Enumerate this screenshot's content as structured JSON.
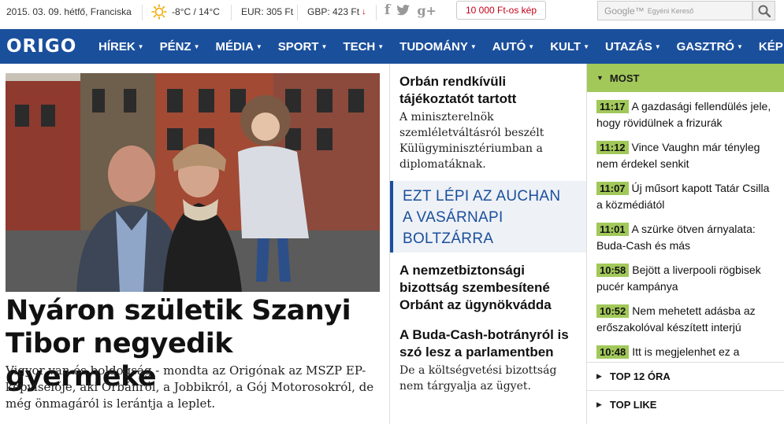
{
  "topbar": {
    "date": "2015. 03. 09. hétfő, Franciska",
    "weather": "-8°C / 14°C",
    "eur": "EUR: 305 Ft",
    "gbp": "GBP: 423 Ft",
    "gbp_trend": "↓",
    "promo": "10 000 Ft-os kép",
    "search_brand": "Google™",
    "search_placeholder": "Egyéni Kereső"
  },
  "nav": {
    "logo": "ORIGO",
    "items": [
      {
        "label": "HÍREK"
      },
      {
        "label": "PÉNZ"
      },
      {
        "label": "MÉDIA"
      },
      {
        "label": "SPORT"
      },
      {
        "label": "TECH"
      },
      {
        "label": "TUDOMÁNY"
      },
      {
        "label": "AUTÓ"
      },
      {
        "label": "KULT"
      },
      {
        "label": "UTAZÁS"
      },
      {
        "label": "GASZTRÓ"
      },
      {
        "label": "KÉP"
      }
    ]
  },
  "hero": {
    "title": "Nyáron születik Szanyi Tibor negyedik gyermeke",
    "lead": "Vigyor van és boldogság - mondta az Origónak az MSZP EP-képviselője, aki Orbánról, a Jobbikról, a Gój Motorosokról, de még önmagáról is lerántja a leplet."
  },
  "middle": {
    "story1_title": "Orbán rendkívüli tájékoztatót tartott",
    "story1_lead": "A miniszterelnök szemléletváltásról beszélt Külügyminisztériumban a diplomatáknak.",
    "feature_lines": [
      "EZT LÉPI AZ AUCHAN",
      "A VASÁRNAPI",
      "BOLTZÁRRA"
    ],
    "story2_title": "A nemzetbiztonsági bizottság szembesítené Orbánt az ügynökvádda",
    "story3_title": "A Buda-Cash-botrányról is szó lesz a parlamentben",
    "story3_lead": "De a költségvetési bizottság nem tárgyalja az ügyet."
  },
  "right": {
    "most_label": "MOST",
    "news": [
      {
        "time": "11:17",
        "text": "A gazdasági fellendülés jele, hogy rövidülnek a frizurák"
      },
      {
        "time": "11:12",
        "text": "Vince Vaughn már tényleg nem érdekel senkit"
      },
      {
        "time": "11:07",
        "text": "Új műsort kapott Tatár Csilla a közmédiától"
      },
      {
        "time": "11:01",
        "text": "A szürke ötven árnyalata: Buda-Cash és más"
      },
      {
        "time": "10:58",
        "text": "Bejött a liverpooli rögbisek pucér kampánya"
      },
      {
        "time": "10:52",
        "text": "Nem mehetett adásba az erőszakolóval készített interjú"
      },
      {
        "time": "10:48",
        "text": "Itt is megjelenhet ez a"
      }
    ],
    "top12_label": "TOP 12 ÓRA",
    "toplike_label": "TOP LIKE"
  },
  "colors": {
    "brand_blue": "#1a4f9c",
    "accent_green": "#a2c85a",
    "promo_red": "#c40018"
  }
}
